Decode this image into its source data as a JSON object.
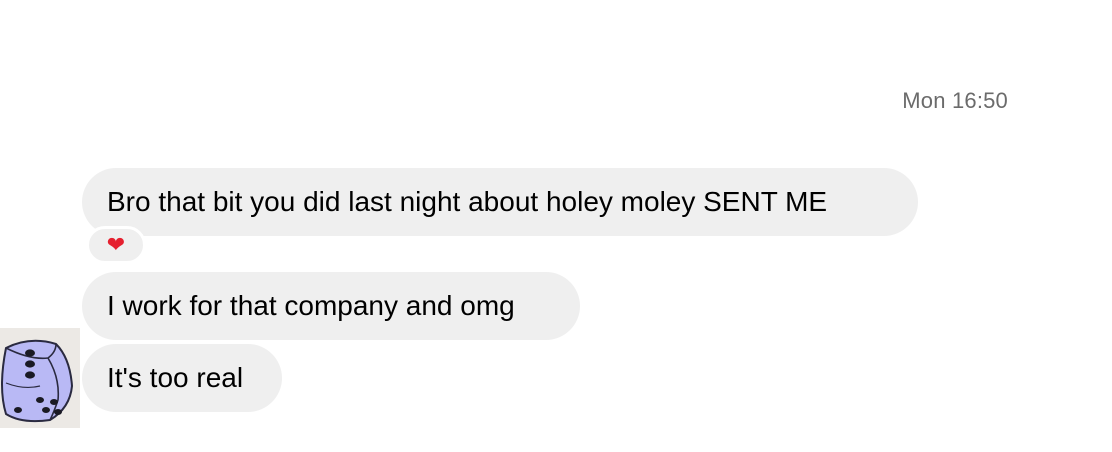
{
  "conversation": {
    "timestamp": "Mon 16:50",
    "messages": [
      {
        "text": "Bro that bit you did last night about holey moley SENT ME",
        "reaction": "heart"
      },
      {
        "text": "I work for that company and omg"
      },
      {
        "text": "It's too real"
      }
    ],
    "reaction_glyph": "❤",
    "avatar_icon": "dice-avatar"
  },
  "colors": {
    "bubble_bg": "#efefef",
    "timestamp_text": "#6b6b6b",
    "heart": "#e5202f",
    "avatar_fill": "#b9b9f5"
  }
}
